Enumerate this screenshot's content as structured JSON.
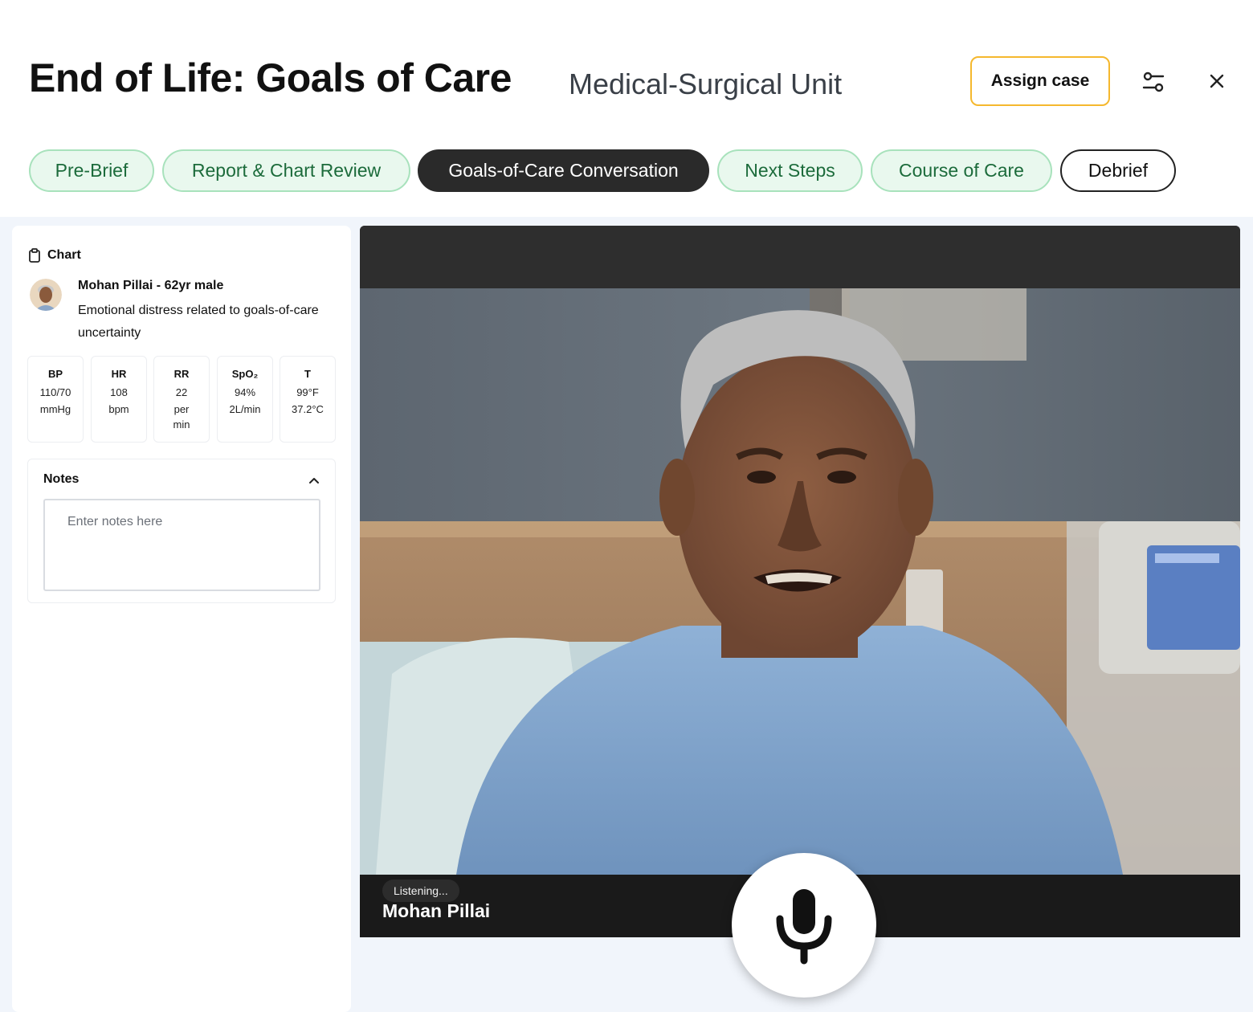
{
  "header": {
    "title": "End of Life: Goals of Care",
    "subtitle": "Medical-Surgical Unit",
    "assign_label": "Assign case",
    "settings_icon": "sliders-icon",
    "close_icon": "close-icon"
  },
  "tabs": [
    {
      "label": "Pre-Brief",
      "state": "done"
    },
    {
      "label": "Report & Chart Review",
      "state": "done"
    },
    {
      "label": "Goals-of-Care Conversation",
      "state": "active"
    },
    {
      "label": "Next Steps",
      "state": "done"
    },
    {
      "label": "Course of Care",
      "state": "done"
    },
    {
      "label": "Debrief",
      "state": "todo"
    }
  ],
  "chart": {
    "heading": "Chart",
    "icon": "clipboard-icon",
    "patient_name": "Mohan Pillai - 62yr male",
    "patient_desc": "Emotional distress related to goals-of-care uncertainty",
    "vitals": [
      {
        "label": "BP",
        "value": "110/70",
        "unit": "mmHg"
      },
      {
        "label": "HR",
        "value": "108",
        "unit": "bpm"
      },
      {
        "label": "RR",
        "value": "22",
        "unit": "per min"
      },
      {
        "label": "SpO₂",
        "value": "94%",
        "unit": "2L/min"
      },
      {
        "label": "T",
        "value": "99°F",
        "unit": "37.2°C"
      }
    ]
  },
  "notes": {
    "title": "Notes",
    "placeholder": "Enter notes here",
    "value": ""
  },
  "video": {
    "status": "Listening...",
    "speaker": "Mohan Pillai",
    "mic_icon": "microphone-icon"
  },
  "colors": {
    "accent_yellow": "#f5b82e",
    "tab_done_bg": "#e9f8ee",
    "tab_done_border": "#a8e2bc",
    "tab_done_text": "#1c6b3b",
    "tab_active_bg": "#2a2a2a"
  }
}
